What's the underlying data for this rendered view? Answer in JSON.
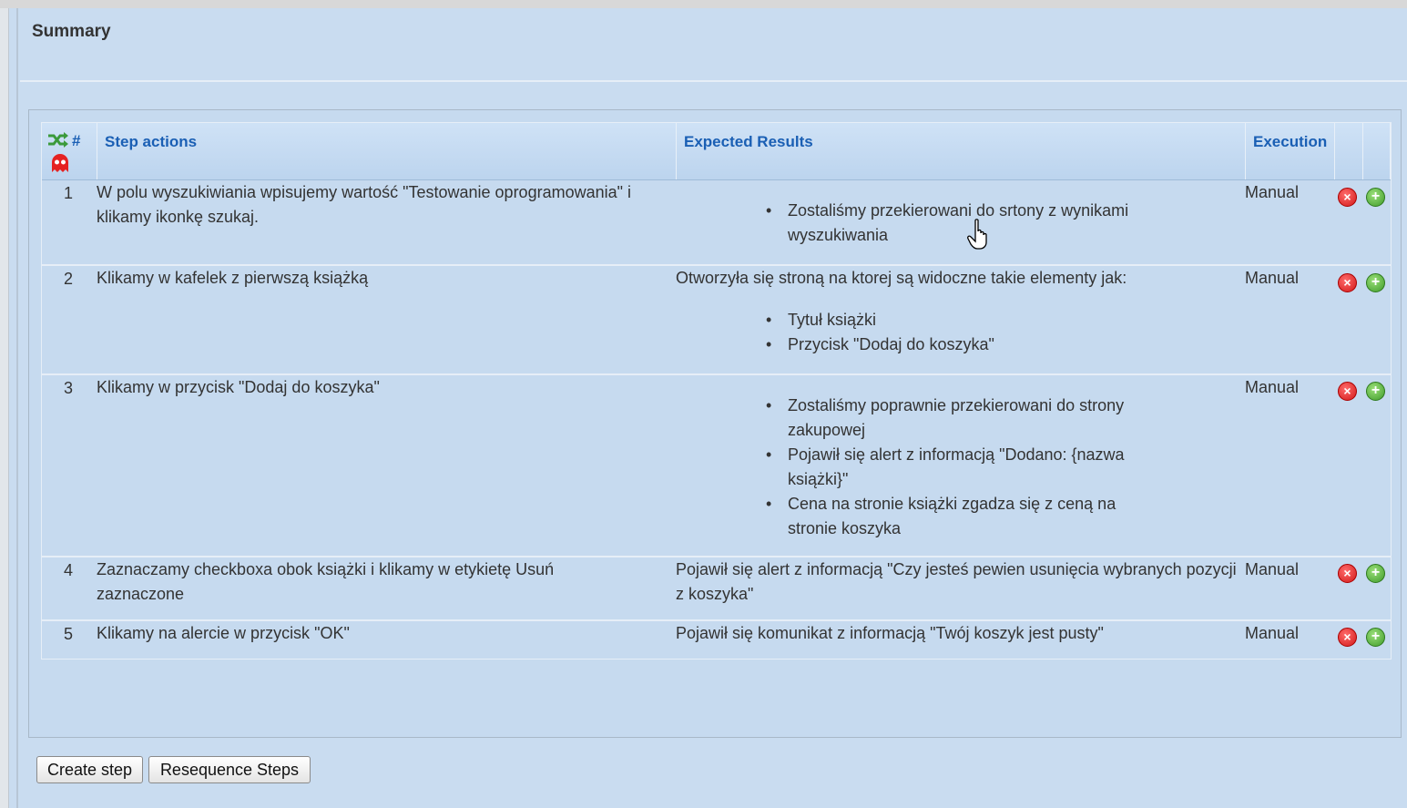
{
  "summary": {
    "title": "Summary"
  },
  "table": {
    "headers": {
      "number": "#",
      "step_actions": "Step actions",
      "expected_results": "Expected Results",
      "execution": "Execution"
    },
    "header_icons": [
      "shuffle-icon",
      "ghost-icon"
    ],
    "rows": [
      {
        "number": "1",
        "step_action": "W polu wyszukiwiania wpisujemy wartość \"Testowanie oprogramowania\" i klikamy ikonkę szukaj.",
        "expected_intro": "",
        "expected_items": [
          "Zostaliśmy przekierowani do srtony z wynikami wyszukiwania"
        ],
        "execution": "Manual"
      },
      {
        "number": "2",
        "step_action": "Klikamy w kafelek z pierwszą książką",
        "expected_intro": "Otworzyła się stroną na ktorej są widoczne takie elementy jak:",
        "expected_items": [
          "Tytuł książki",
          "Przycisk \"Dodaj do koszyka\""
        ],
        "execution": "Manual"
      },
      {
        "number": "3",
        "step_action": "Klikamy w przycisk \"Dodaj do koszyka\"",
        "expected_intro": "",
        "expected_items": [
          "Zostaliśmy poprawnie przekierowani do strony zakupowej",
          "Pojawił się alert z informacją \"Dodano: {nazwa książki}\"",
          "Cena na stronie książki zgadza się z ceną na stronie koszyka"
        ],
        "execution": "Manual"
      },
      {
        "number": "4",
        "step_action": "Zaznaczamy checkboxa obok książki i klikamy w etykietę Usuń zaznaczone",
        "expected_intro": "Pojawił się alert z informacją \"Czy jesteś pewien usunięcia wybranych pozycji z koszyka\"",
        "expected_items": [],
        "execution": "Manual"
      },
      {
        "number": "5",
        "step_action": "Klikamy na alercie w przycisk \"OK\"",
        "expected_intro": "Pojawił się komunikat z informacją \"Twój koszyk jest pusty\"",
        "expected_items": [],
        "execution": "Manual"
      }
    ],
    "row_icons": {
      "delete": "delete-icon",
      "add": "add-icon"
    }
  },
  "buttons": {
    "create_step": "Create step",
    "resequence_steps": "Resequence Steps"
  },
  "colors": {
    "background": "#c9dcf0",
    "header_text": "#1a5fb4",
    "delete": "#d21a1a",
    "add": "#3f9b2a"
  }
}
